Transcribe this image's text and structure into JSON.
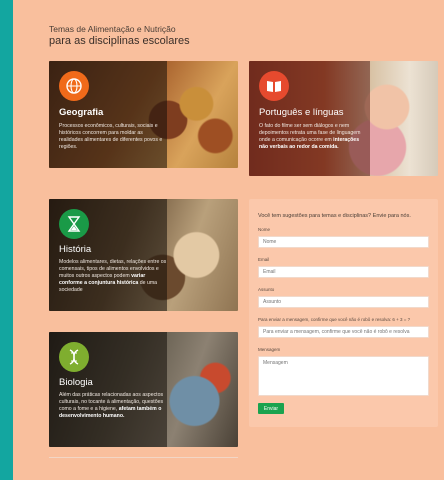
{
  "header": {
    "line1": "Temas de Alimentação e Nutrição",
    "line2": "para as disciplinas escolares"
  },
  "cards": {
    "geografia": {
      "title": "Geografia",
      "icon": "globe-icon",
      "desc": "Processos econômicos, culturais, sociais e históricos concorrem para moldar as realidades alimentares de diferentes povos e regiões."
    },
    "portugues": {
      "title": "Português e línguas",
      "icon": "book-icon",
      "desc_lead": "O fato do filme ser sem diálogos e nem depoimentos retrata uma fase de linguagem onde a comunicação ocorre em",
      "desc_bold": "interações não verbais ao redor da comida."
    },
    "historia": {
      "title": "História",
      "icon": "hourglass-icon",
      "desc_lead": "Modelos alimentares, dietas, relações entre os comensais, tipos de alimentos envolvidos e muitos outros aspectos podem",
      "desc_bold": "variar conforme a conjuntura histórica",
      "desc_tail": "de uma sociedade"
    },
    "biologia": {
      "title": "Biologia",
      "icon": "dna-icon",
      "desc_lead": "Além das práticas relacionadas aos aspectos culturais, no tocante à alimentação, questões como a fome e a higiene,",
      "desc_bold": "afetam também o desenvolvimento humano."
    }
  },
  "form": {
    "intro": "Você tem sugestões para temas e disciplinas? Envie para nós.",
    "name_label": "Nome",
    "name_placeholder": "Nome",
    "email_label": "Email",
    "email_placeholder": "Email",
    "subject_label": "Assunto",
    "subject_placeholder": "Assunto",
    "captcha_label": "Para enviar a mensagem, confirme que você não é robô e resolva: 6 + 3 = ?",
    "captcha_placeholder": "Para enviar a mensagem, confirme que você não é robô e resolva",
    "message_label": "Mensagem",
    "message_placeholder": "Mensagem",
    "submit_label": "Enviar"
  },
  "colors": {
    "background": "#f9bf9d",
    "side_stripe": "#13a6a0",
    "geo_badge": "#f06a1a",
    "port_badge": "#e64a2e",
    "hist_badge": "#1a9a47",
    "bio_badge": "#7fae2f",
    "submit": "#1aa34f"
  }
}
